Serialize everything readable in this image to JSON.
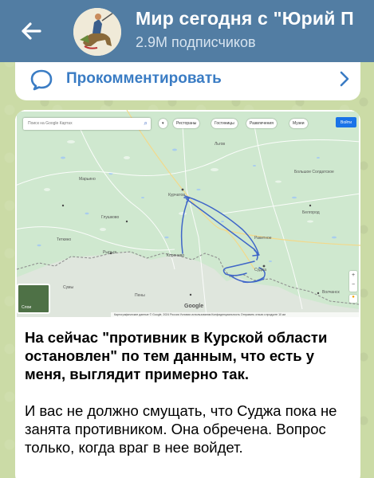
{
  "colors": {
    "header_bg": "#527da3",
    "chat_bg": "#cbdba6",
    "link_blue": "#3a7cc4",
    "route_blue": "#3f66c8",
    "map_green": "#cfe8cf"
  },
  "header": {
    "back_icon": "arrow-left-icon",
    "channel_title": "Мир сегодня с \"Юрий П",
    "subscribers": "2.9M подписчиков"
  },
  "comment_bar": {
    "icon": "speech-bubble-icon",
    "label": "Прокомментировать",
    "arrow_icon": "chevron-right-icon"
  },
  "map": {
    "search_placeholder": "Поиск на Google Картах",
    "chips": [
      "Рестораны",
      "Гостиницы",
      "Развлечения",
      "Музеи"
    ],
    "signin": "Войти",
    "layers_label": "Слои",
    "footer": "Картографические данные © Google, 2024   Россия   Условия использования   Конфиденциальность   Отправить отзыв о продукте   10 км",
    "google_logo": "Google",
    "places": [
      {
        "name": "Курчатов"
      },
      {
        "name": "Глушково"
      },
      {
        "name": "Рыльск"
      },
      {
        "name": "Льгов"
      },
      {
        "name": "Суджа"
      },
      {
        "name": "Белгород"
      },
      {
        "name": "Большое Солдатское"
      },
      {
        "name": "Коренево"
      },
      {
        "name": "Теткино"
      },
      {
        "name": "Сумы"
      },
      {
        "name": "Пены"
      },
      {
        "name": "Марьино"
      },
      {
        "name": "Волчанск"
      },
      {
        "name": "Ракитное"
      }
    ]
  },
  "post": {
    "paragraph1": "На сейчас \"противник в Курской области остановлен\" по тем данным, что есть у меня, выглядит примерно так.",
    "paragraph2": "И вас не должно смущать, что Суджа пока не занята противником. Она обречена. Вопрос только, когда враг в нее войдет."
  }
}
